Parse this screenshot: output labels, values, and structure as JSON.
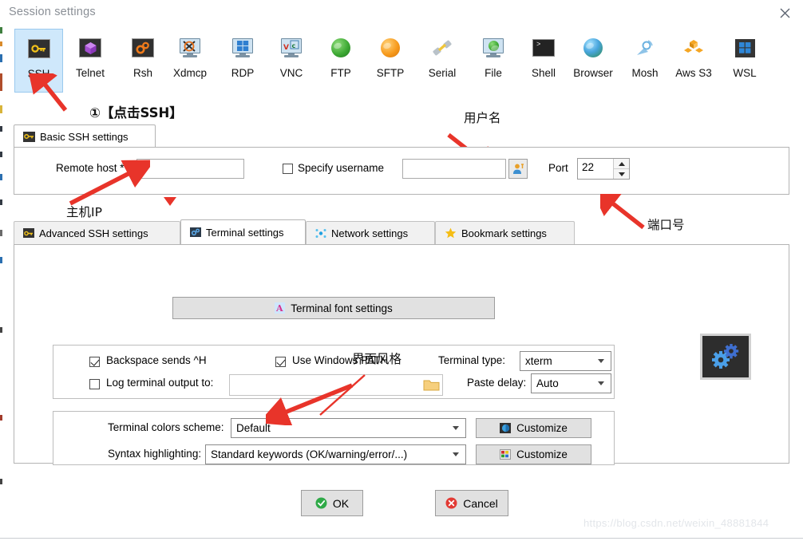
{
  "window": {
    "title": "Session settings",
    "close_icon": "close-icon"
  },
  "session_types": [
    {
      "label": "SSH",
      "icon": "ssh-key-icon",
      "selected": true
    },
    {
      "label": "Telnet",
      "icon": "telnet-cube-icon",
      "selected": false
    },
    {
      "label": "Rsh",
      "icon": "rsh-gears-icon",
      "selected": false
    },
    {
      "label": "Xdmcp",
      "icon": "xdmcp-monitor-icon",
      "selected": false
    },
    {
      "label": "RDP",
      "icon": "rdp-windows-icon",
      "selected": false
    },
    {
      "label": "VNC",
      "icon": "vnc-monitor-icon",
      "selected": false
    },
    {
      "label": "FTP",
      "icon": "ftp-globe-icon",
      "selected": false
    },
    {
      "label": "SFTP",
      "icon": "sftp-globe-icon",
      "selected": false
    },
    {
      "label": "Serial",
      "icon": "serial-plug-icon",
      "selected": false
    },
    {
      "label": "File",
      "icon": "file-monitor-icon",
      "selected": false
    },
    {
      "label": "Shell",
      "icon": "shell-console-icon",
      "selected": false
    },
    {
      "label": "Browser",
      "icon": "browser-globe-icon",
      "selected": false
    },
    {
      "label": "Mosh",
      "icon": "mosh-antenna-icon",
      "selected": false
    },
    {
      "label": "Aws S3",
      "icon": "aws-s3-boxes-icon",
      "selected": false
    },
    {
      "label": "WSL",
      "icon": "wsl-windows-icon",
      "selected": false
    }
  ],
  "upper_tabs": [
    {
      "label": "Basic SSH settings",
      "icon": "key-icon",
      "active": true
    }
  ],
  "basic_ssh": {
    "remote_host_label": "Remote host *",
    "remote_host_value": "",
    "remote_host_placeholder": "",
    "specify_username_label": "Specify username",
    "specify_username_checked": false,
    "username_value": "",
    "username_placeholder": "",
    "user_picker_icon": "user-picker-icon",
    "port_label": "Port",
    "port_value": "22"
  },
  "lower_tabs": [
    {
      "label": "Advanced SSH settings",
      "icon": "key-icon",
      "active": false
    },
    {
      "label": "Terminal settings",
      "icon": "terminal-gear-icon",
      "active": true
    },
    {
      "label": "Network settings",
      "icon": "network-dots-icon",
      "active": false
    },
    {
      "label": "Bookmark settings",
      "icon": "star-icon",
      "active": false
    }
  ],
  "terminal_settings": {
    "font_settings_button": "Terminal font settings",
    "font_settings_icon": "font-A-icon",
    "backspace_label": "Backspace sends ^H",
    "backspace_checked": true,
    "use_windows_path_label": "Use Windows PATH",
    "use_windows_path_checked": true,
    "log_output_label": "Log terminal output to:",
    "log_output_checked": false,
    "log_output_value": "",
    "folder_icon": "folder-icon",
    "terminal_type_label": "Terminal type:",
    "terminal_type_value": "xterm",
    "paste_delay_label": "Paste delay:",
    "paste_delay_value": "Auto",
    "colors_scheme_label": "Terminal colors scheme:",
    "colors_scheme_value": "Default",
    "colors_customize_label": "Customize",
    "colors_customize_icon": "color-wheel-icon",
    "syntax_label": "Syntax highlighting:",
    "syntax_value": "Standard keywords (OK/warning/error/...)",
    "syntax_customize_label": "Customize",
    "syntax_customize_icon": "syntax-monitor-icon",
    "gears_icon": "gears-icon"
  },
  "footer": {
    "ok_label": "OK",
    "ok_icon": "check-circle-icon",
    "cancel_label": "Cancel",
    "cancel_icon": "x-circle-icon"
  },
  "annotations": [
    {
      "text": "①【点击SSH】",
      "name": "annotation-click-ssh"
    },
    {
      "text": "用户名",
      "name": "annotation-username"
    },
    {
      "text": "主机IP",
      "name": "annotation-host-ip"
    },
    {
      "text": "端口号",
      "name": "annotation-port-number"
    },
    {
      "text": "界面风格",
      "name": "annotation-ui-style"
    }
  ],
  "watermark": "https://blog.csdn.net/weixin_48881844",
  "colors": {
    "accent_red": "#e8342a",
    "selected_blue": "#cfe8fb",
    "panel_gray": "#e1e1e1"
  }
}
